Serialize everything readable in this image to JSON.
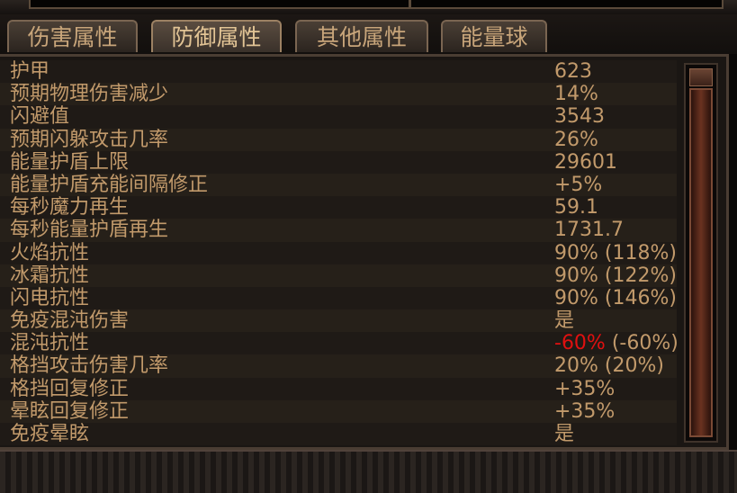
{
  "tabs": [
    {
      "label": "伤害属性"
    },
    {
      "label": "防御属性"
    },
    {
      "label": "其他属性"
    },
    {
      "label": "能量球"
    }
  ],
  "stats": [
    {
      "label": "护甲",
      "value": "623"
    },
    {
      "label": "预期物理伤害减少",
      "value": "14%"
    },
    {
      "label": "闪避值",
      "value": "3543"
    },
    {
      "label": "预期闪躲攻击几率",
      "value": "26%"
    },
    {
      "label": "能量护盾上限",
      "value": "29601"
    },
    {
      "label": "能量护盾充能间隔修正",
      "value": "+5%"
    },
    {
      "label": "每秒魔力再生",
      "value": "59.1"
    },
    {
      "label": "每秒能量护盾再生",
      "value": "1731.7"
    },
    {
      "label": "火焰抗性",
      "value": "90% (118%)"
    },
    {
      "label": "冰霜抗性",
      "value": "90% (122%)"
    },
    {
      "label": "闪电抗性",
      "value": "90% (146%)"
    },
    {
      "label": "免疫混沌伤害",
      "value": "是"
    },
    {
      "label": "混沌抗性",
      "value": "-60%",
      "value_extra": " (-60%)"
    },
    {
      "label": "格挡攻击伤害几率",
      "value": "20% (20%)"
    },
    {
      "label": "格挡回复修正",
      "value": "+35%"
    },
    {
      "label": "晕眩回复修正",
      "value": "+35%"
    },
    {
      "label": "免疫晕眩",
      "value": "是"
    }
  ],
  "colors": {
    "text": "#c29a6b",
    "negative": "#e01010"
  },
  "active_tab": "防御属性"
}
